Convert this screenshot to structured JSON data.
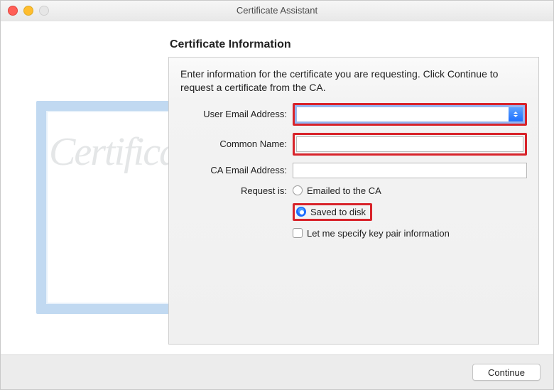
{
  "window": {
    "title": "Certificate Assistant"
  },
  "heading": "Certificate Information",
  "instruction": "Enter information for the certificate you are requesting. Click Continue to request a certificate from the CA.",
  "form": {
    "user_email_label": "User Email Address:",
    "user_email_value": "",
    "common_name_label": "Common Name:",
    "common_name_value": "",
    "ca_email_label": "CA Email Address:",
    "ca_email_value": "",
    "request_is_label": "Request is:",
    "options": {
      "emailed": "Emailed to the CA",
      "saved": "Saved to disk"
    },
    "selected_option": "saved",
    "keypair_checkbox": "Let me specify key pair information",
    "keypair_checked": false
  },
  "watermark": {
    "text": "Certificate"
  },
  "footer": {
    "continue": "Continue"
  },
  "highlights": {
    "color": "#d8232a"
  }
}
